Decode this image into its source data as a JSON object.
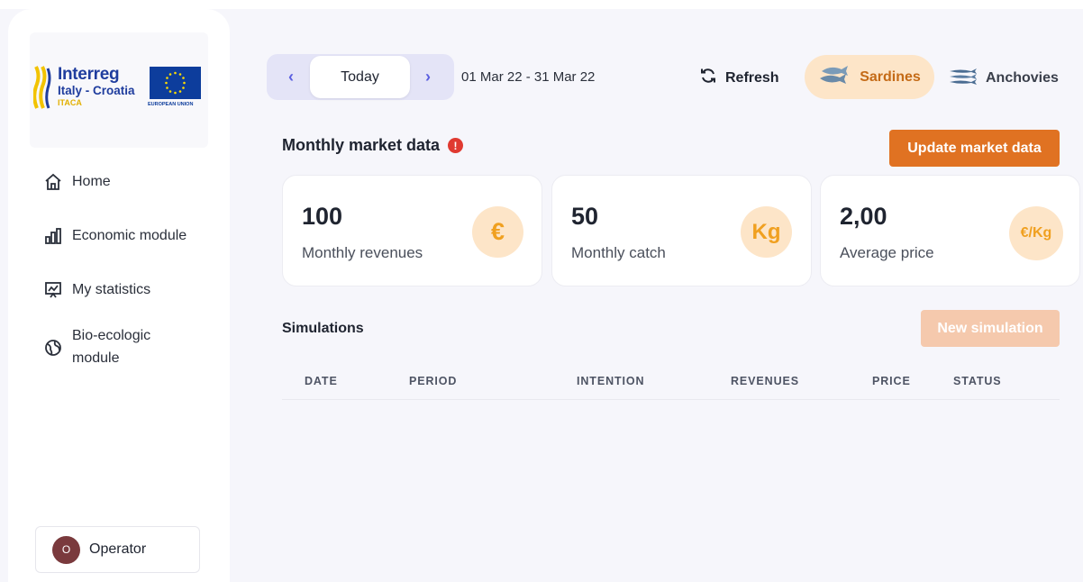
{
  "sidebar": {
    "logo": {
      "title": "Interreg",
      "subtitle": "Italy - Croatia",
      "project": "ITACA",
      "eu_label": "EUROPEAN UNION"
    },
    "nav": [
      {
        "label": "Home",
        "icon": "home-icon"
      },
      {
        "label": "Economic module",
        "icon": "bar-chart-icon"
      },
      {
        "label": "My statistics",
        "icon": "presentation-chart-icon"
      },
      {
        "label": "Bio-ecologic module",
        "icon": "globe-icon"
      }
    ],
    "user": {
      "initial": "O",
      "name": "Operator"
    }
  },
  "toolbar": {
    "prev_icon": "chevron-left-icon",
    "today_label": "Today",
    "next_icon": "chevron-right-icon",
    "date_range": "01 Mar 22 - 31 Mar 22",
    "refresh_label": "Refresh",
    "species": [
      {
        "label": "Sardines",
        "selected": true
      },
      {
        "label": "Anchovies",
        "selected": false
      }
    ]
  },
  "market": {
    "title": "Monthly market data",
    "alert_symbol": "!",
    "update_label": "Update market data",
    "cards": [
      {
        "value": "100",
        "label": "Monthly revenues",
        "badge": "€"
      },
      {
        "value": "50",
        "label": "Monthly catch",
        "badge": "Kg"
      },
      {
        "value": "2,00",
        "label": "Average price",
        "badge": "€/Kg"
      }
    ]
  },
  "simulations": {
    "title": "Simulations",
    "new_label": "New simulation",
    "columns": [
      "DATE",
      "PERIOD",
      "INTENTION",
      "REVENUES",
      "PRICE",
      "STATUS"
    ],
    "rows": []
  },
  "colors": {
    "accent": "#e07222",
    "accent_light": "#fde5c8",
    "nav_accent": "#5b5fe0",
    "alert": "#e03a31"
  }
}
